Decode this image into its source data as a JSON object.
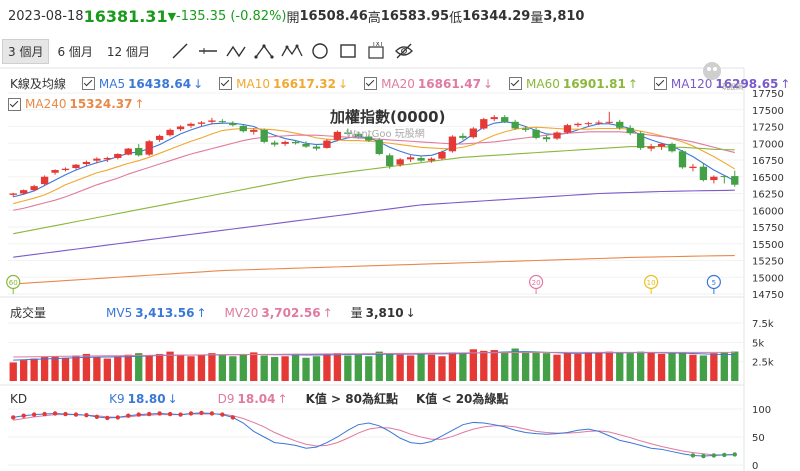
{
  "header": {
    "date": "2023-08-18",
    "price": "16381.31",
    "change": "-135.35 (-0.82%)",
    "open_label": "開",
    "open": "16508.46",
    "high_label": "高",
    "high": "16583.95",
    "low_label": "低",
    "low": "16344.29",
    "vol_label": "量",
    "vol": "3,810"
  },
  "toolbar": {
    "periods": [
      "3 個月",
      "6 個月",
      "12 個月"
    ],
    "active_period": "3 個月",
    "tools": [
      "line-tool-icon",
      "horizontal-line-icon",
      "wave-tool-icon",
      "fib-icon",
      "pattern-icon",
      "circle-tool-icon",
      "rectangle-tool-icon",
      "text-tool-icon",
      "hide-icon"
    ]
  },
  "kline_legend": {
    "title": "K線及均線",
    "items": [
      {
        "name": "MA5",
        "value": "16438.64",
        "dir": "↓",
        "color": "#3a78d8"
      },
      {
        "name": "MA10",
        "value": "16617.32",
        "dir": "↓",
        "color": "#f0a830"
      },
      {
        "name": "MA20",
        "value": "16861.47",
        "dir": "↓",
        "color": "#e07aa0"
      },
      {
        "name": "MA60",
        "value": "16901.81",
        "dir": "↑",
        "color": "#8ab83a"
      },
      {
        "name": "MA120",
        "value": "16298.65",
        "dir": "↑",
        "color": "#7a5ac8"
      },
      {
        "name": "MA240",
        "value": "15324.37",
        "dir": "↑",
        "color": "#e8894a"
      }
    ]
  },
  "chart_title": "加權指數(0000)",
  "watermark": "WantGoo 玩股網",
  "price_axis": [
    "17750",
    "17500",
    "17250",
    "17000",
    "16750",
    "16500",
    "16250",
    "16000",
    "15750",
    "15500",
    "15250",
    "15000",
    "14750"
  ],
  "markers": [
    {
      "label": "60",
      "color": "#8ab83a"
    },
    {
      "label": "20",
      "color": "#e07aa0"
    },
    {
      "label": "10",
      "color": "#e8c020"
    },
    {
      "label": "5",
      "color": "#3a78d8"
    }
  ],
  "volume_legend": {
    "title": "成交量",
    "items": [
      {
        "name": "MV5",
        "value": "3,413.56",
        "dir": "↑",
        "color": "#3a78d8"
      },
      {
        "name": "MV20",
        "value": "3,702.56",
        "dir": "↑",
        "color": "#e07aa0"
      },
      {
        "name": "量",
        "value": "3,810",
        "dir": "↓",
        "color": "#333333"
      }
    ]
  },
  "volume_axis": [
    "7.5k",
    "5k",
    "2.5k"
  ],
  "kd_legend": {
    "title": "KD",
    "items": [
      {
        "name": "K9",
        "value": "18.80",
        "dir": "↓",
        "color": "#3a78d8"
      },
      {
        "name": "D9",
        "value": "18.04",
        "dir": "↑",
        "color": "#e07aa0"
      }
    ],
    "note1": "K值 > 80為紅點",
    "note2": "K值 < 20為綠點"
  },
  "kd_axis": [
    "100",
    "50",
    "0"
  ],
  "chart_data": {
    "type": "candlestick",
    "ylim": [
      14750,
      17750
    ],
    "candles": [
      [
        16230,
        16260,
        16200,
        16250
      ],
      [
        16250,
        16310,
        16230,
        16300
      ],
      [
        16300,
        16380,
        16280,
        16360
      ],
      [
        16390,
        16520,
        16370,
        16500
      ],
      [
        16560,
        16610,
        16530,
        16600
      ],
      [
        16600,
        16640,
        16580,
        16620
      ],
      [
        16630,
        16690,
        16610,
        16680
      ],
      [
        16690,
        16740,
        16660,
        16720
      ],
      [
        16740,
        16790,
        16700,
        16770
      ],
      [
        16760,
        16800,
        16720,
        16780
      ],
      [
        16780,
        16850,
        16760,
        16840
      ],
      [
        16830,
        16930,
        16820,
        16920
      ],
      [
        16930,
        16990,
        16800,
        16820
      ],
      [
        16830,
        17050,
        16810,
        17030
      ],
      [
        17050,
        17130,
        17020,
        17110
      ],
      [
        17120,
        17220,
        17100,
        17200
      ],
      [
        17210,
        17270,
        17180,
        17250
      ],
      [
        17260,
        17310,
        17230,
        17290
      ],
      [
        17290,
        17330,
        17250,
        17310
      ],
      [
        17320,
        17380,
        17280,
        17340
      ],
      [
        17330,
        17360,
        17290,
        17320
      ],
      [
        17300,
        17330,
        17250,
        17270
      ],
      [
        17260,
        17280,
        17160,
        17180
      ],
      [
        17170,
        17220,
        17130,
        17200
      ],
      [
        17200,
        17220,
        17000,
        17020
      ],
      [
        17010,
        17040,
        16950,
        16980
      ],
      [
        16990,
        17040,
        16960,
        17020
      ],
      [
        17020,
        17050,
        16980,
        17000
      ],
      [
        16990,
        17030,
        16930,
        16950
      ],
      [
        16950,
        16990,
        16890,
        16920
      ],
      [
        16930,
        17060,
        16920,
        17040
      ],
      [
        17050,
        17190,
        17030,
        17170
      ],
      [
        17160,
        17220,
        17120,
        17140
      ],
      [
        17140,
        17170,
        17070,
        17100
      ],
      [
        17100,
        17130,
        17020,
        17040
      ],
      [
        17050,
        17080,
        16820,
        16840
      ],
      [
        16820,
        16850,
        16620,
        16660
      ],
      [
        16680,
        16780,
        16650,
        16760
      ],
      [
        16760,
        16820,
        16720,
        16790
      ],
      [
        16780,
        16810,
        16720,
        16740
      ],
      [
        16740,
        16790,
        16710,
        16770
      ],
      [
        16770,
        16890,
        16750,
        16870
      ],
      [
        16880,
        17120,
        16860,
        17100
      ],
      [
        17110,
        17150,
        17050,
        17080
      ],
      [
        17090,
        17240,
        17070,
        17220
      ],
      [
        17220,
        17380,
        17200,
        17360
      ],
      [
        17360,
        17420,
        17330,
        17390
      ],
      [
        17390,
        17420,
        17300,
        17320
      ],
      [
        17320,
        17350,
        17200,
        17220
      ],
      [
        17220,
        17250,
        17170,
        17200
      ],
      [
        17200,
        17230,
        17060,
        17080
      ],
      [
        17090,
        17120,
        17020,
        17060
      ],
      [
        17070,
        17180,
        17050,
        17160
      ],
      [
        17160,
        17290,
        17140,
        17270
      ],
      [
        17270,
        17310,
        17240,
        17290
      ],
      [
        17290,
        17320,
        17250,
        17300
      ],
      [
        17300,
        17340,
        17270,
        17310
      ],
      [
        17310,
        17470,
        17290,
        17320
      ],
      [
        17320,
        17350,
        17200,
        17230
      ],
      [
        17230,
        17270,
        17120,
        17150
      ],
      [
        17150,
        17180,
        16900,
        16930
      ],
      [
        16920,
        16990,
        16880,
        16950
      ],
      [
        16950,
        17010,
        16900,
        16990
      ],
      [
        16990,
        17010,
        16860,
        16880
      ],
      [
        16880,
        16900,
        16620,
        16640
      ],
      [
        16630,
        16690,
        16580,
        16650
      ],
      [
        16650,
        16700,
        16430,
        16450
      ],
      [
        16450,
        16520,
        16400,
        16500
      ],
      [
        16510,
        16520,
        16400,
        16500
      ],
      [
        16510,
        16590,
        16350,
        16381
      ]
    ],
    "ma": {
      "MA5": [
        16200,
        16240,
        16290,
        16370,
        16450,
        16530,
        16600,
        16660,
        16710,
        16750,
        16800,
        16850,
        16870,
        16920,
        16980,
        17060,
        17140,
        17200,
        17250,
        17290,
        17300,
        17300,
        17280,
        17250,
        17180,
        17120,
        17070,
        17040,
        17000,
        16980,
        16990,
        17040,
        17080,
        17100,
        17080,
        17020,
        16940,
        16880,
        16830,
        16810,
        16820,
        16870,
        16950,
        17030,
        17140,
        17240,
        17300,
        17320,
        17300,
        17250,
        17190,
        17140,
        17130,
        17150,
        17200,
        17250,
        17290,
        17290,
        17260,
        17220,
        17110,
        17050,
        17000,
        16960,
        16880,
        16800,
        16700,
        16600,
        16520,
        16439
      ],
      "MA10": [
        16100,
        16140,
        16180,
        16230,
        16300,
        16380,
        16440,
        16500,
        16560,
        16600,
        16650,
        16700,
        16740,
        16790,
        16850,
        16910,
        16970,
        17030,
        17080,
        17140,
        17190,
        17210,
        17220,
        17220,
        17210,
        17200,
        17180,
        17150,
        17120,
        17080,
        17060,
        17050,
        17040,
        17040,
        17030,
        17020,
        17000,
        16980,
        16960,
        16940,
        16930,
        16920,
        16920,
        16940,
        16980,
        17050,
        17120,
        17170,
        17210,
        17230,
        17240,
        17230,
        17220,
        17210,
        17210,
        17210,
        17220,
        17220,
        17220,
        17210,
        17180,
        17150,
        17110,
        17070,
        17020,
        16960,
        16880,
        16800,
        16710,
        16617
      ],
      "MA20": [
        16000,
        16030,
        16070,
        16110,
        16150,
        16200,
        16260,
        16320,
        16380,
        16430,
        16480,
        16540,
        16590,
        16640,
        16690,
        16740,
        16790,
        16840,
        16880,
        16920,
        16960,
        17000,
        17040,
        17070,
        17090,
        17100,
        17110,
        17120,
        17120,
        17120,
        17110,
        17100,
        17090,
        17080,
        17070,
        17060,
        17050,
        17040,
        17030,
        17020,
        17010,
        17000,
        16990,
        16990,
        17000,
        17010,
        17020,
        17040,
        17060,
        17080,
        17100,
        17120,
        17140,
        17150,
        17160,
        17170,
        17170,
        17170,
        17170,
        17160,
        17140,
        17120,
        17100,
        17080,
        17050,
        17020,
        16980,
        16940,
        16900,
        16861
      ],
      "MA60": [
        15650,
        15680,
        15710,
        15740,
        15770,
        15800,
        15830,
        15860,
        15890,
        15920,
        15950,
        15980,
        16010,
        16040,
        16070,
        16100,
        16130,
        16160,
        16190,
        16220,
        16250,
        16280,
        16310,
        16340,
        16370,
        16400,
        16430,
        16460,
        16490,
        16510,
        16530,
        16550,
        16570,
        16590,
        16610,
        16630,
        16650,
        16670,
        16690,
        16710,
        16730,
        16750,
        16770,
        16790,
        16800,
        16810,
        16820,
        16830,
        16840,
        16850,
        16860,
        16870,
        16880,
        16890,
        16900,
        16910,
        16920,
        16930,
        16940,
        16950,
        16950,
        16950,
        16950,
        16940,
        16940,
        16930,
        16920,
        16910,
        16905,
        16902
      ],
      "MA120": [
        15300,
        15320,
        15340,
        15360,
        15380,
        15400,
        15420,
        15440,
        15460,
        15480,
        15500,
        15520,
        15540,
        15560,
        15580,
        15600,
        15620,
        15640,
        15660,
        15680,
        15700,
        15720,
        15740,
        15760,
        15780,
        15800,
        15820,
        15840,
        15860,
        15880,
        15900,
        15920,
        15940,
        15960,
        15980,
        16000,
        16020,
        16040,
        16060,
        16080,
        16090,
        16100,
        16110,
        16120,
        16130,
        16140,
        16150,
        16160,
        16170,
        16180,
        16190,
        16200,
        16210,
        16220,
        16230,
        16240,
        16250,
        16255,
        16260,
        16265,
        16270,
        16275,
        16280,
        16283,
        16286,
        16289,
        16292,
        16294,
        16296,
        16299
      ],
      "MA240": [
        14900,
        14910,
        14920,
        14930,
        14940,
        14950,
        14960,
        14970,
        14980,
        14990,
        15000,
        15010,
        15020,
        15030,
        15040,
        15050,
        15060,
        15070,
        15080,
        15090,
        15100,
        15105,
        15110,
        15115,
        15120,
        15125,
        15130,
        15135,
        15140,
        15145,
        15150,
        15155,
        15160,
        15165,
        15170,
        15175,
        15180,
        15185,
        15190,
        15195,
        15200,
        15205,
        15210,
        15215,
        15220,
        15225,
        15230,
        15235,
        15240,
        15245,
        15250,
        15255,
        15260,
        15265,
        15270,
        15275,
        15280,
        15285,
        15290,
        15295,
        15300,
        15302,
        15305,
        15308,
        15311,
        15314,
        15317,
        15320,
        15322,
        15324
      ]
    },
    "marker_index": [
      0,
      50,
      61,
      67
    ],
    "volume": {
      "ylim": [
        0,
        7500
      ],
      "values": [
        2400,
        2700,
        2900,
        3100,
        3200,
        3000,
        3300,
        3500,
        3100,
        2900,
        3200,
        3400,
        3600,
        3300,
        3500,
        3800,
        3400,
        3200,
        3300,
        3600,
        3400,
        3200,
        3500,
        3700,
        3300,
        3100,
        3200,
        3400,
        3000,
        3200,
        3500,
        3600,
        3300,
        3400,
        3200,
        3800,
        3600,
        3400,
        3300,
        3500,
        3400,
        3200,
        3700,
        3600,
        4100,
        3900,
        4000,
        3800,
        4200,
        3800,
        3700,
        3600,
        3400,
        3600,
        3500,
        3700,
        3600,
        3800,
        3700,
        3600,
        3800,
        3700,
        3500,
        3600,
        3700,
        3400,
        3300,
        3600,
        3700,
        3810
      ],
      "MV5": [
        2700,
        2750,
        2800,
        2860,
        2900,
        2950,
        3000,
        3050,
        3080,
        3100,
        3120,
        3150,
        3200,
        3250,
        3300,
        3320,
        3340,
        3350,
        3360,
        3380,
        3400,
        3400,
        3410,
        3420,
        3420,
        3400,
        3390,
        3380,
        3370,
        3360,
        3380,
        3400,
        3420,
        3440,
        3450,
        3460,
        3470,
        3480,
        3480,
        3490,
        3500,
        3500,
        3520,
        3540,
        3600,
        3650,
        3700,
        3750,
        3780,
        3800,
        3760,
        3700,
        3650,
        3600,
        3580,
        3600,
        3620,
        3640,
        3650,
        3660,
        3670,
        3660,
        3640,
        3620,
        3600,
        3560,
        3500,
        3460,
        3430,
        3414
      ],
      "MV20": [
        3100,
        3120,
        3140,
        3160,
        3180,
        3200,
        3220,
        3240,
        3250,
        3260,
        3270,
        3280,
        3300,
        3320,
        3340,
        3350,
        3360,
        3370,
        3380,
        3390,
        3400,
        3410,
        3420,
        3430,
        3440,
        3450,
        3460,
        3470,
        3480,
        3490,
        3500,
        3510,
        3520,
        3530,
        3540,
        3550,
        3560,
        3570,
        3580,
        3590,
        3600,
        3610,
        3620,
        3630,
        3640,
        3650,
        3660,
        3670,
        3680,
        3690,
        3700,
        3700,
        3700,
        3700,
        3700,
        3700,
        3700,
        3700,
        3700,
        3700,
        3700,
        3700,
        3700,
        3700,
        3700,
        3700,
        3700,
        3700,
        3702,
        3703
      ]
    },
    "kd": {
      "ylim": [
        0,
        100
      ],
      "K": [
        85,
        88,
        90,
        91,
        92,
        91,
        90,
        89,
        86,
        84,
        85,
        88,
        90,
        91,
        92,
        91,
        90,
        92,
        93,
        92,
        90,
        85,
        75,
        60,
        50,
        40,
        38,
        35,
        30,
        32,
        40,
        50,
        62,
        72,
        75,
        70,
        60,
        48,
        40,
        38,
        42,
        52,
        62,
        72,
        76,
        75,
        72,
        68,
        62,
        58,
        56,
        55,
        56,
        58,
        62,
        64,
        60,
        52,
        44,
        40,
        35,
        30,
        28,
        24,
        20,
        17,
        16,
        17,
        18,
        18.8
      ],
      "D": [
        80,
        83,
        86,
        88,
        90,
        90,
        90,
        89,
        88,
        86,
        85,
        86,
        88,
        89,
        90,
        90,
        90,
        91,
        91,
        91,
        91,
        88,
        83,
        76,
        68,
        58,
        50,
        43,
        37,
        34,
        35,
        40,
        48,
        57,
        64,
        67,
        66,
        62,
        55,
        50,
        46,
        46,
        51,
        58,
        64,
        68,
        70,
        70,
        68,
        64,
        60,
        58,
        57,
        57,
        58,
        60,
        61,
        59,
        54,
        49,
        43,
        38,
        33,
        29,
        25,
        22,
        20,
        18,
        18,
        18.04
      ]
    }
  }
}
